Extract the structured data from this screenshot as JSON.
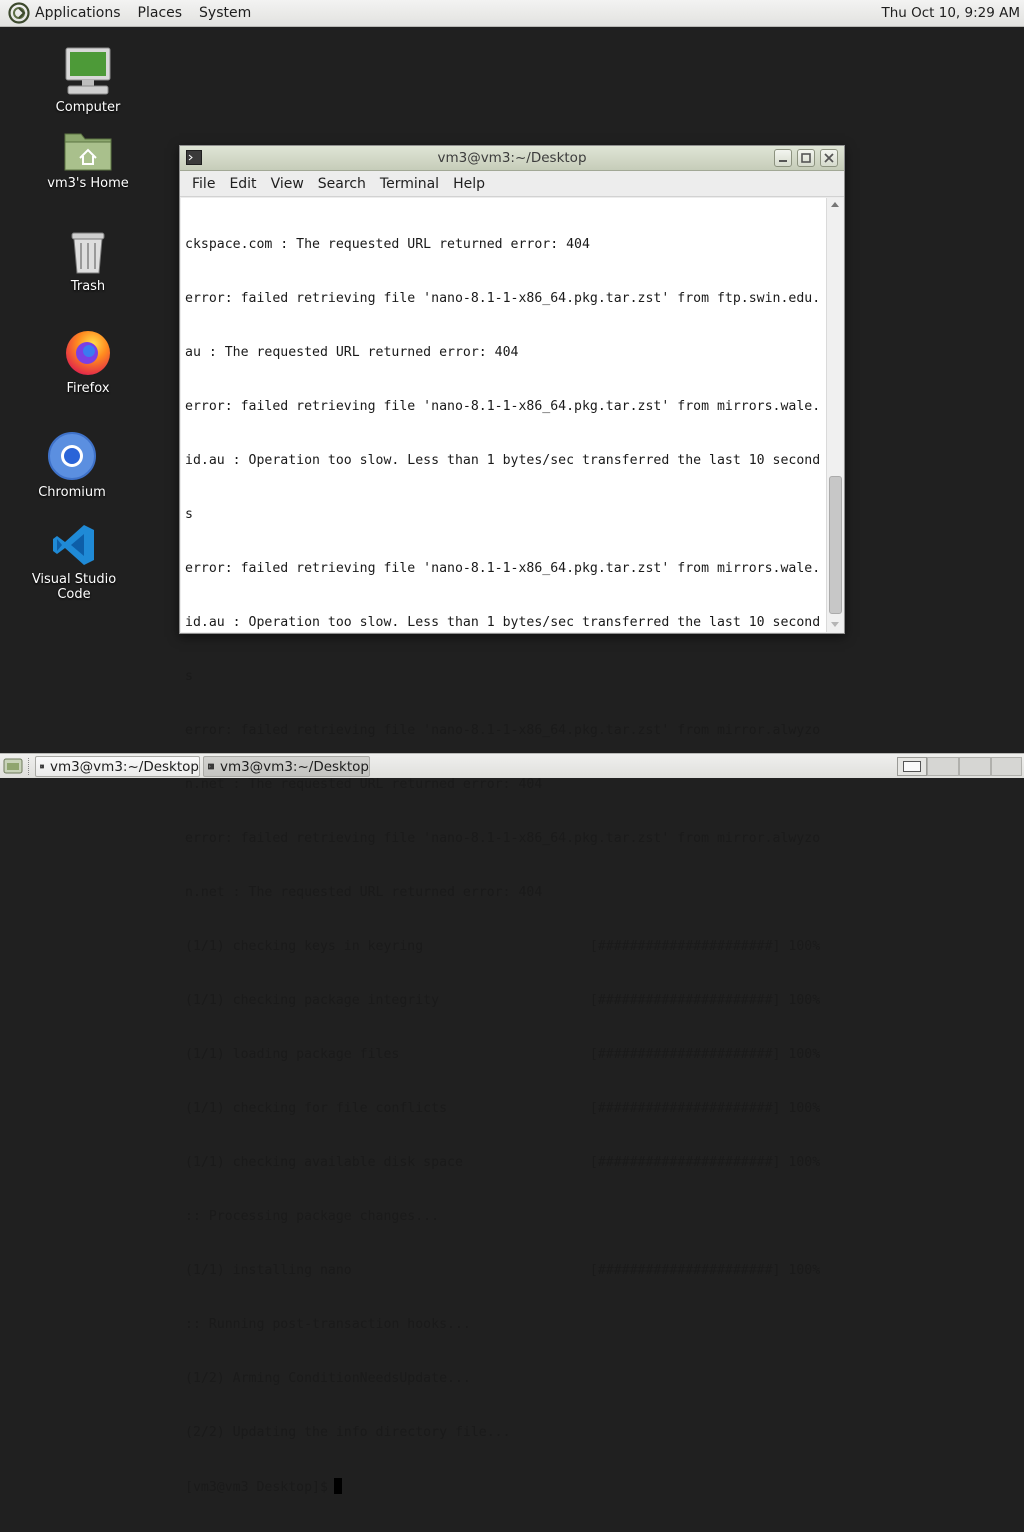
{
  "top_panel": {
    "menu": [
      "Applications",
      "Places",
      "System"
    ],
    "clock": "Thu Oct 10,  9:29 AM"
  },
  "desktop": {
    "icons": [
      {
        "label": "Computer",
        "icon": "computer-icon"
      },
      {
        "label": "vm3's Home",
        "icon": "home-folder-icon"
      },
      {
        "label": "Trash",
        "icon": "trash-icon"
      },
      {
        "label": "Firefox",
        "icon": "firefox-icon"
      },
      {
        "label": "Chromium",
        "icon": "chromium-icon"
      },
      {
        "label": "Visual Studio Code",
        "icon": "vscode-icon"
      }
    ]
  },
  "window": {
    "title": "vm3@vm3:~/Desktop",
    "menu": [
      "File",
      "Edit",
      "View",
      "Search",
      "Terminal",
      "Help"
    ],
    "terminal_lines": [
      "ckspace.com : The requested URL returned error: 404",
      "error: failed retrieving file 'nano-8.1-1-x86_64.pkg.tar.zst' from ftp.swin.edu.",
      "au : The requested URL returned error: 404",
      "error: failed retrieving file 'nano-8.1-1-x86_64.pkg.tar.zst' from mirrors.wale.",
      "id.au : Operation too slow. Less than 1 bytes/sec transferred the last 10 second",
      "s",
      "error: failed retrieving file 'nano-8.1-1-x86_64.pkg.tar.zst' from mirrors.wale.",
      "id.au : Operation too slow. Less than 1 bytes/sec transferred the last 10 second",
      "s",
      "error: failed retrieving file 'nano-8.1-1-x86_64.pkg.tar.zst' from mirror.alwyzo",
      "n.net : The requested URL returned error: 404",
      "error: failed retrieving file 'nano-8.1-1-x86_64.pkg.tar.zst' from mirror.alwyzo",
      "n.net : The requested URL returned error: 404",
      "(1/1) checking keys in keyring                     [######################] 100%",
      "(1/1) checking package integrity                   [######################] 100%",
      "(1/1) loading package files                        [######################] 100%",
      "(1/1) checking for file conflicts                  [######################] 100%",
      "(1/1) checking available disk space                [######################] 100%",
      ":: Processing package changes...",
      "(1/1) installing nano                              [######################] 100%",
      ":: Running post-transaction hooks...",
      "(1/2) Arming ConditionNeedsUpdate...",
      "(2/2) Updating the info directory file...",
      "[vm3@vm3 Desktop]$"
    ]
  },
  "taskbar": {
    "tasks": [
      "vm3@vm3:~/Desktop",
      "vm3@vm3:~/Desktop"
    ]
  }
}
